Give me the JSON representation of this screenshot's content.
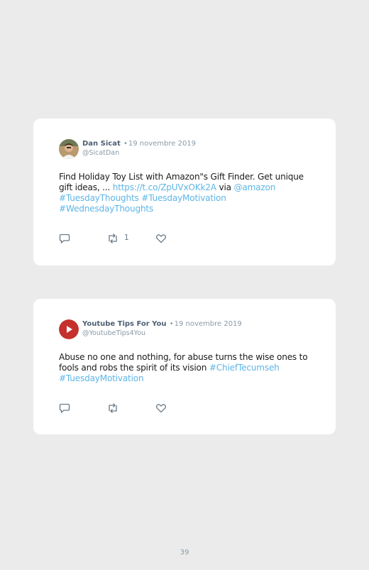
{
  "tweets": [
    {
      "author": "Dan Sicat",
      "separator": "•",
      "date": "19 novembre 2019",
      "handle": "@SicatDan",
      "text_1": "Find Holiday Toy List with Amazon\"s Gift Finder. Get unique gift ideas, ... ",
      "link_1": "https://t.co/ZpUVxOKk2A",
      "text_2": " via ",
      "mention": "@amazon",
      "hashtag_1": "#TuesdayThoughts",
      "hashtag_2": "#TuesdayMotivation",
      "hashtag_3": "#WednesdayThoughts",
      "retweet_count": "1",
      "avatar_icon": "person-photo"
    },
    {
      "author": "Youtube Tips For You",
      "separator": "•",
      "date": "19 novembre 2019",
      "handle": "@YoutubeTips4You",
      "text_1": "Abuse no one and nothing, for abuse turns the wise ones to fools and robs the spirit of its vision ",
      "hashtag_1": "#ChiefTecumseh",
      "hashtag_2": "#TuesdayMotivation",
      "avatar_icon": "youtube-play",
      "avatar_color": "#c4302b"
    }
  ],
  "page_number": "39",
  "colors": {
    "background": "#ebebeb",
    "card": "#ffffff",
    "link": "#5eb5e6",
    "author": "#4e5f73",
    "muted": "#8a9aa6"
  }
}
